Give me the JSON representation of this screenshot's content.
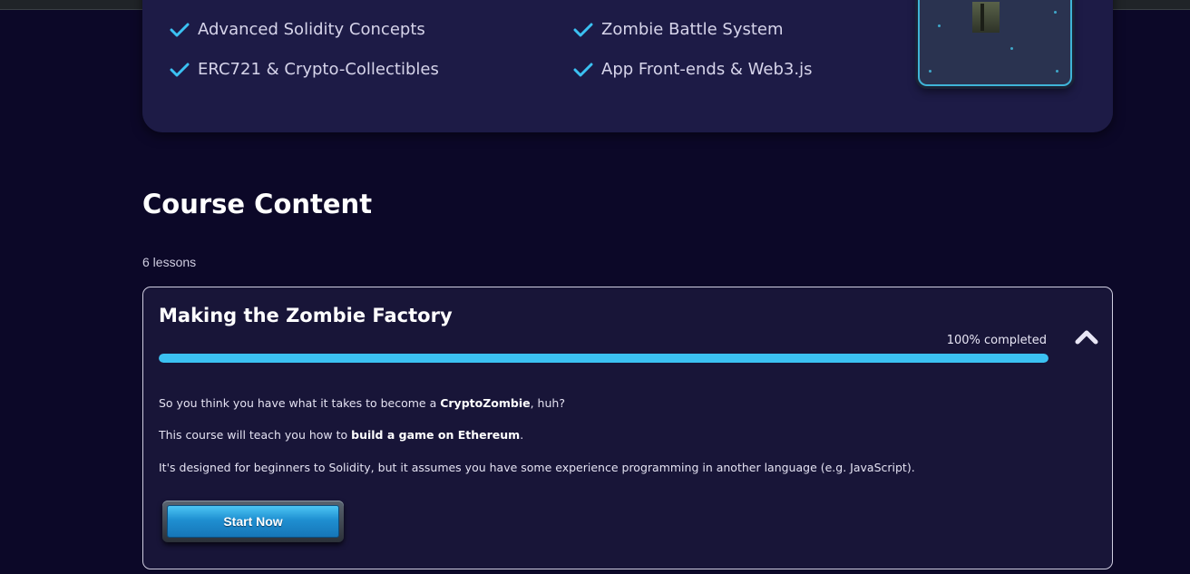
{
  "features": [
    {
      "label": "Advanced Solidity Concepts"
    },
    {
      "label": "Zombie Battle System"
    },
    {
      "label": "ERC721 & Crypto-Collectibles"
    },
    {
      "label": "App Front-ends & Web3.js"
    }
  ],
  "course_content": {
    "heading": "Course Content",
    "lesson_count": "6 lessons"
  },
  "lesson": {
    "title": "Making the Zombie Factory",
    "progress_label": "100% completed",
    "progress_fraction": 1.0,
    "description": [
      {
        "pre": "So you think you have what it takes to become a ",
        "bold": "CryptoZombie",
        "post": ", huh?"
      },
      {
        "pre": "This course will teach you how to ",
        "bold": "build a game on Ethereum",
        "post": "."
      },
      {
        "pre": "It's designed for beginners to Solidity, but it assumes you have some experience programming in another language (e.g. JavaScript).",
        "bold": "",
        "post": ""
      }
    ],
    "start_button": "Start Now"
  },
  "colors": {
    "background": "#0c0828",
    "card": "#1d1b46",
    "accent": "#3bc1f2",
    "check": "#3bc1f2"
  },
  "icons": {
    "check": "check-icon",
    "collapse": "chevron-up-icon"
  }
}
